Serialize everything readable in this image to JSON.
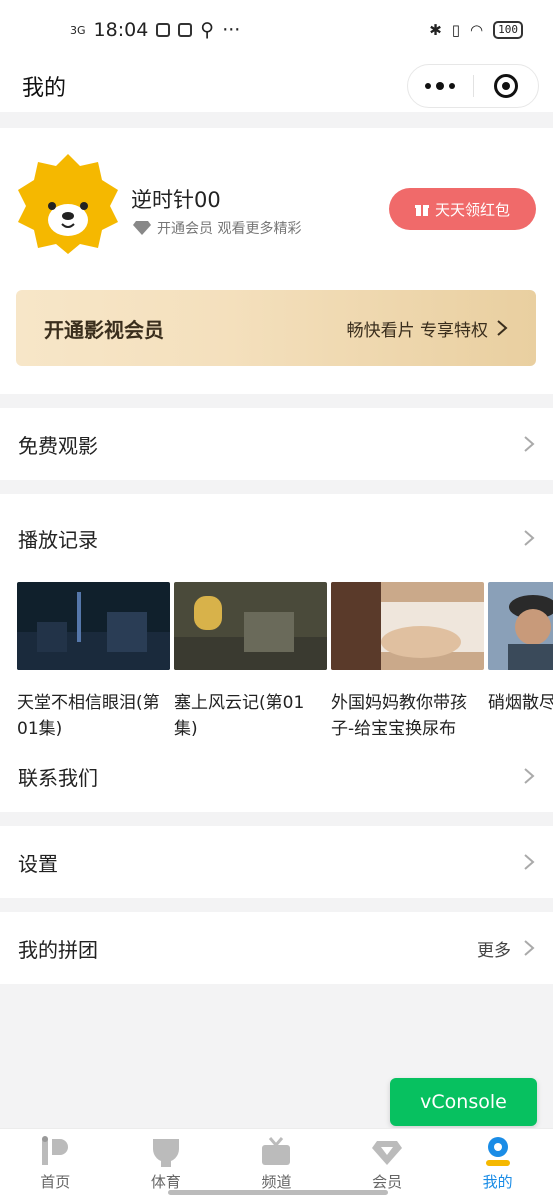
{
  "status_bar": {
    "network": "3G",
    "time": "18:04",
    "more": "···",
    "battery": "100"
  },
  "header": {
    "title": "我的"
  },
  "profile": {
    "username": "逆时针00",
    "vip_hint": "开通会员 观看更多精彩",
    "redpack_button": "天天领红包"
  },
  "vip_banner": {
    "title": "开通影视会员",
    "desc": "畅快看片 专享特权"
  },
  "menu": {
    "free_movies": "免费观影",
    "history": "播放记录",
    "contact": "联系我们",
    "settings": "设置",
    "group_buy": "我的拼团",
    "group_buy_more": "更多"
  },
  "history_items": [
    {
      "title": "天堂不相信眼泪(第01集)"
    },
    {
      "title": "塞上风云记(第01集)"
    },
    {
      "title": "外国妈妈教你带孩子-给宝宝换尿布"
    },
    {
      "title": "硝烟散尽"
    }
  ],
  "vconsole": "vConsole",
  "tabs": [
    {
      "label": "首页",
      "icon": "home-icon"
    },
    {
      "label": "体育",
      "icon": "sports-icon"
    },
    {
      "label": "频道",
      "icon": "tv-channel-icon"
    },
    {
      "label": "会员",
      "icon": "diamond-icon"
    },
    {
      "label": "我的",
      "icon": "user-icon",
      "active": true
    }
  ],
  "colors": {
    "redpack": "#f06a6a",
    "tab_active": "#1a8ce6",
    "vconsole": "#07c160",
    "avatar": "#f5b800"
  }
}
